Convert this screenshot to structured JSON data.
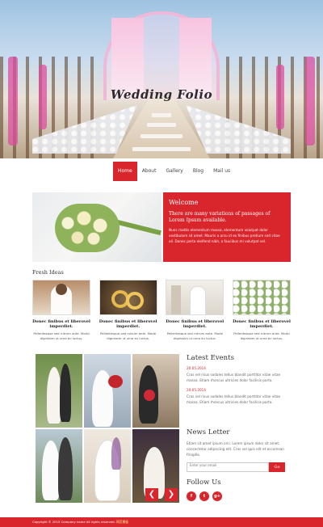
{
  "hero": {
    "title": "Wedding Folio"
  },
  "nav": {
    "items": [
      "Home",
      "About",
      "Gallery",
      "Blog",
      "Mail us"
    ]
  },
  "welcome": {
    "heading": "Welcome",
    "subheading": "There are many variations of passages of Lorem Ipsum available.",
    "body": "Nunc mattis elementum massa, elementum volutpat dolor vestibulum sit amet. Mauris a arcu id ex finibus pretium sed vitae ali. Donec porta eleifend nibh, a faucibus mi volutpat vel."
  },
  "fresh_ideas": {
    "title": "Fresh Ideas",
    "cards": [
      {
        "title": "Donec finibus et liberovel imperdiet.",
        "text": "Pellentesque sed rutrum ante. Morbi dignissim ut urna eu luctus."
      },
      {
        "title": "Donec finibus et liberovel imperdiet.",
        "text": "Pellentesque sed rutrum ante. Morbi dignissim ut urna eu luctus."
      },
      {
        "title": "Donec finibus et liberovel imperdiet.",
        "text": "Pellentesque sed rutrum ante. Morbi dignissim ut urna eu luctus."
      },
      {
        "title": "Donec finibus et liberovel imperdiet.",
        "text": "Pellentesque sed rutrum ante. Morbi dignissim ut urna eu luctus."
      }
    ]
  },
  "events": {
    "title": "Latest Events",
    "items": [
      {
        "date": "20.05.2014",
        "text": "Cras vel risus sodales tellus blandit porttitor vitae vitae massa. Etiam rhoncus ultricies dolor facilisis porta."
      },
      {
        "date": "20.05.2014",
        "text": "Cras vel risus sodales tellus blandit porttitor vitae vitae massa. Etiam rhoncus ultricies dolor facilisis porta."
      }
    ]
  },
  "newsletter": {
    "title": "News Letter",
    "text": "Etiam sit amet ipsum orci. Lorem ipsum dolor sit amet, consectetur adipiscing elit. Cras vel quis elit et accumsan fringilla.",
    "placeholder": "Enter your email",
    "button": "Go"
  },
  "follow": {
    "title": "Follow Us",
    "icons": [
      "f",
      "t",
      "g+"
    ]
  },
  "gallery": {
    "prev": "❮",
    "next": "❯"
  },
  "footer": {
    "text": "Copyright © 2015 Company name All rights reserved.",
    "link": "网页模板"
  },
  "colors": {
    "accent": "#d9262c"
  }
}
